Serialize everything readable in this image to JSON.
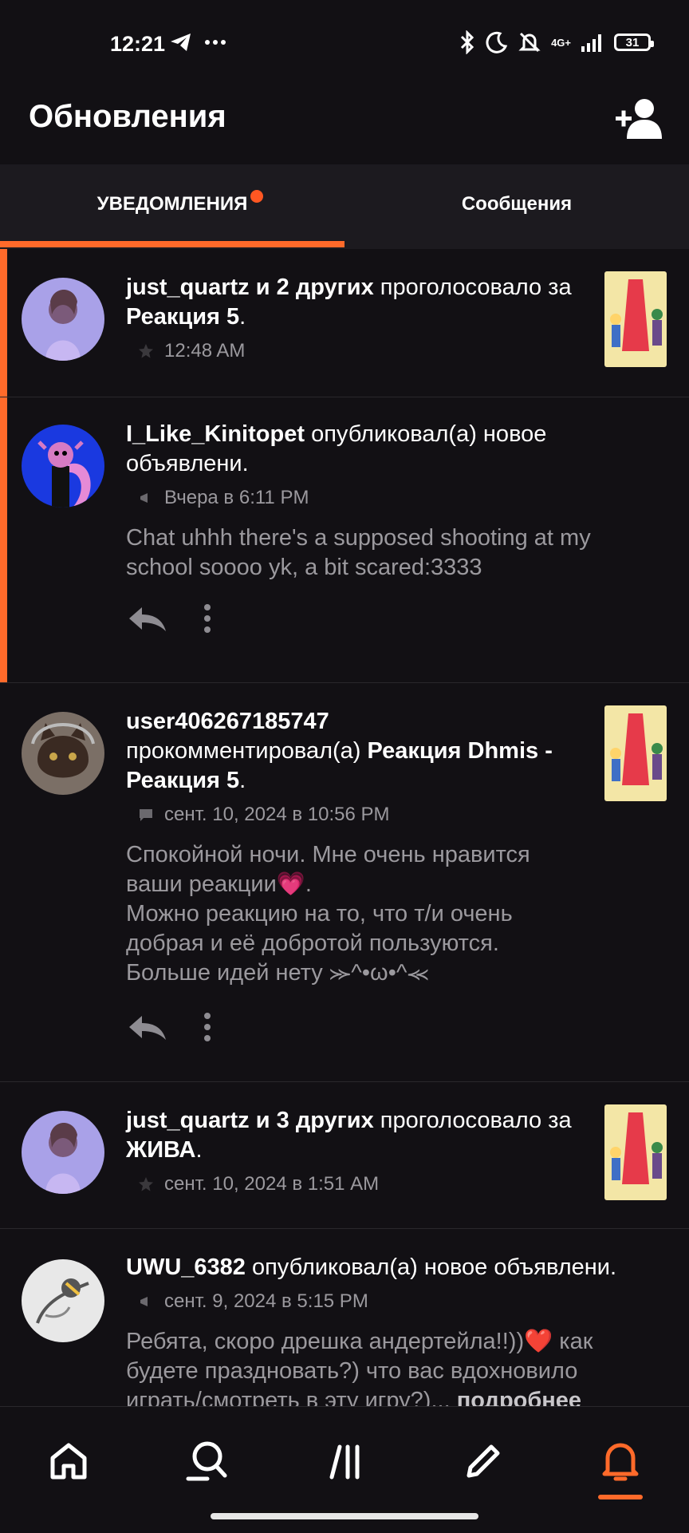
{
  "status_bar": {
    "time": "12:21",
    "signal_text": "4G+",
    "battery": "31"
  },
  "header": {
    "title": "Обновления"
  },
  "tabs": [
    {
      "label": "УВЕДОМЛЕНИЯ"
    },
    {
      "label": "Сообщения"
    }
  ],
  "feed": [
    {
      "user": "just_quartz и 2 других",
      "action": "проголосовало за",
      "target": "Реакция 5",
      "suffix": ".",
      "time": "12:48 AM"
    },
    {
      "user": "I_Like_Kinitopet",
      "action": "опубликовал(а) новое объявлени.",
      "time": "Вчера в 6:11 PM",
      "body": "Chat uhhh there's a supposed shooting at my school soooo yk, a bit scared:3333"
    },
    {
      "user": "user406267185747",
      "action": "прокомментировал(а)",
      "target": "Реакция Dhmis - Реакция 5",
      "suffix": ".",
      "time": "сент. 10, 2024 в 10:56 PM",
      "body_lines": [
        "Спокойной ночи. Мне очень нравится",
        "ваши реакции💗.",
        "Можно реакцию на то, что т/и очень",
        "добрая и её добротой пользуются.",
        "Больше идей нету ⪼^•ω•^⪻"
      ]
    },
    {
      "user": "just_quartz и 3 других",
      "action": "проголосовало за",
      "target": "ЖИВА",
      "suffix": ".",
      "time": "сент. 10, 2024 в 1:51 AM"
    },
    {
      "user": "UWU_6382",
      "action": "опубликовал(а) новое объявлени.",
      "time": "сент. 9, 2024 в 5:15 PM",
      "body_start": "Ребята, скоро дрешка андертейла!!))❤️ как будете праздновать?) что вас вдохновило играть/смотреть в эту игру?)... ",
      "more": "подробнее"
    }
  ],
  "nav": [
    "home-icon",
    "search-icon",
    "library-icon",
    "write-icon",
    "notifications-icon"
  ],
  "colors": {
    "accent": "#ff6a2a",
    "background": "#121014",
    "muted_text": "#9b999e"
  }
}
